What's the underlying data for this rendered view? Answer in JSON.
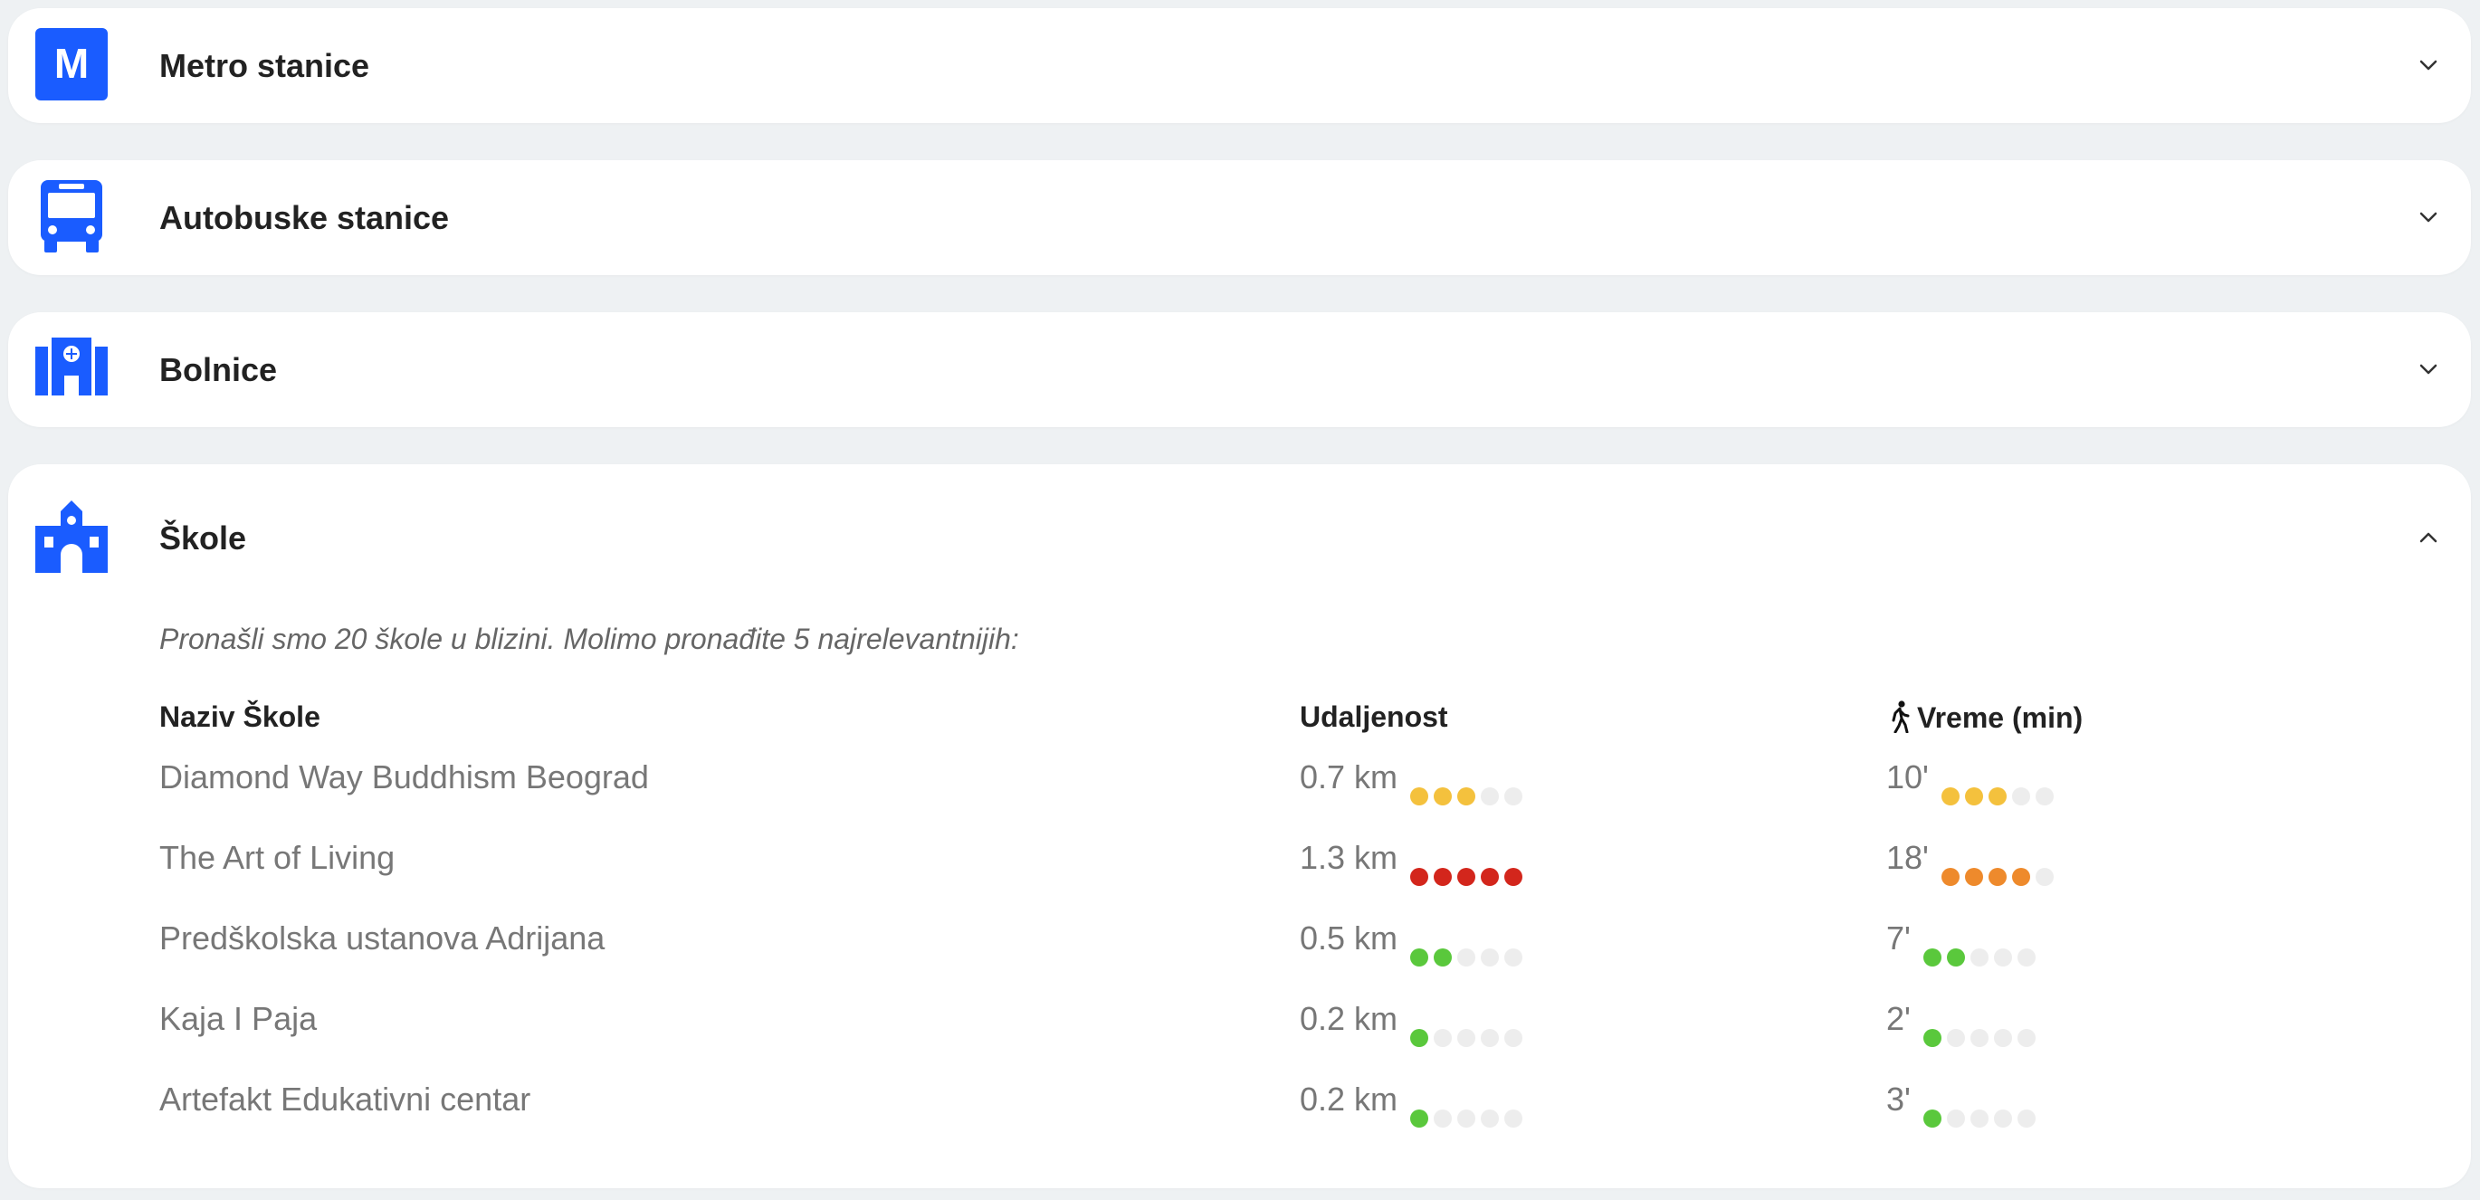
{
  "sections": [
    {
      "title": "Metro stanice",
      "icon": "metro-icon",
      "expanded": false
    },
    {
      "title": "Autobuske stanice",
      "icon": "bus-icon",
      "expanded": false
    },
    {
      "title": "Bolnice",
      "icon": "hospital-icon",
      "expanded": false
    },
    {
      "title": "Škole",
      "icon": "school-icon",
      "expanded": true
    }
  ],
  "metro_icon_letter": "M",
  "schools": {
    "intro": "Pronašli smo 20 škole u blizini. Molimo pronađite 5 najrelevantnijih:",
    "headers": {
      "name": "Naziv Škole",
      "distance": "Udaljenost",
      "time": "Vreme (min)"
    },
    "rows": [
      {
        "name": "Diamond Way Buddhism Beograd",
        "distance": "0.7 km",
        "distance_level": 3,
        "distance_color": "#f4c13d",
        "time": "10'",
        "time_level": 3,
        "time_color": "#f4c13d"
      },
      {
        "name": "The Art of Living",
        "distance": "1.3 km",
        "distance_level": 5,
        "distance_color": "#d3261c",
        "time": "18'",
        "time_level": 4,
        "time_color": "#ee8a2c"
      },
      {
        "name": "Predškolska ustanova Adrijana",
        "distance": "0.5 km",
        "distance_level": 2,
        "distance_color": "#5ac83c",
        "time": "7'",
        "time_level": 2,
        "time_color": "#5ac83c"
      },
      {
        "name": "Kaja I Paja",
        "distance": "0.2 km",
        "distance_level": 1,
        "distance_color": "#5ac83c",
        "time": "2'",
        "time_level": 1,
        "time_color": "#5ac83c"
      },
      {
        "name": "Artefakt Edukativni centar",
        "distance": "0.2 km",
        "distance_level": 1,
        "distance_color": "#5ac83c",
        "time": "3'",
        "time_level": 1,
        "time_color": "#5ac83c"
      }
    ]
  },
  "colors": {
    "accent": "#1a5cff",
    "empty_dot": "#ededed"
  }
}
